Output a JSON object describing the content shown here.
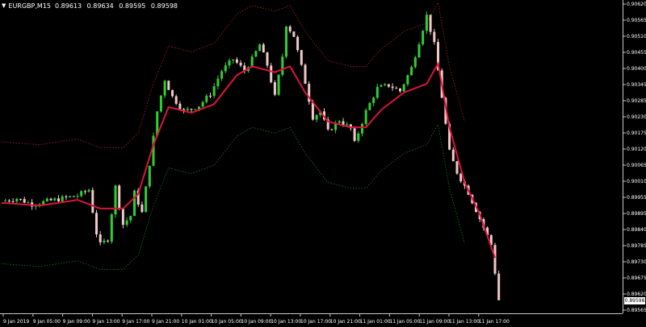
{
  "header": {
    "symbol": "EURGBP,M15",
    "open": "0.89613",
    "high": "0.89634",
    "low": "0.89595",
    "close": "0.89598",
    "menu_icon": "triangle-down-icon"
  },
  "price_axis": {
    "labels": [
      "0.90620",
      "0.90565",
      "0.90510",
      "0.90455",
      "0.90400",
      "0.90345",
      "0.90285",
      "0.90230",
      "0.90175",
      "0.90120",
      "0.90065",
      "0.90010",
      "0.89955",
      "0.89895",
      "0.89840",
      "0.89785",
      "0.89730",
      "0.89675",
      "0.89620",
      "0.89565"
    ],
    "current_price": "0.89598"
  },
  "time_axis": {
    "labels": [
      "9 Jan 2019",
      "9 Jan 05:00",
      "9 Jan 09:00",
      "9 Jan 13:00",
      "9 Jan 17:00",
      "9 Jan 21:00",
      "10 Jan 01:00",
      "10 Jan 05:00",
      "10 Jan 09:00",
      "10 Jan 13:00",
      "10 Jan 17:00",
      "10 Jan 21:00",
      "11 Jan 01:00",
      "11 Jan 05:00",
      "11 Jan 09:00",
      "11 Jan 13:00",
      "11 Jan 17:00"
    ]
  },
  "colors": {
    "background": "#000000",
    "bull_candle": "#32cd32",
    "bear_candle": "#f0c8c8",
    "center_line": "#dc143c",
    "upper_band": "#b22222",
    "lower_band": "#1f7a1f",
    "axis_text": "#ffffff",
    "axis_line": "#c8c8c8"
  },
  "chart_data": {
    "type": "candlestick",
    "ylim": [
      0.89565,
      0.9062
    ],
    "path_anchors": [
      [
        0.8994,
        0
      ],
      [
        0.8995,
        4
      ],
      [
        0.8993,
        8
      ],
      [
        0.8994,
        12
      ],
      [
        0.8995,
        16
      ],
      [
        0.8996,
        20
      ],
      [
        0.8998,
        23
      ],
      [
        0.8983,
        25
      ],
      [
        0.8979,
        26
      ],
      [
        0.8981,
        28
      ],
      [
        0.8999,
        30
      ],
      [
        0.8986,
        32
      ],
      [
        0.8989,
        34
      ],
      [
        0.8997,
        35
      ],
      [
        0.899,
        37
      ],
      [
        0.9007,
        39
      ],
      [
        0.9025,
        41
      ],
      [
        0.9036,
        43
      ],
      [
        0.903,
        45
      ],
      [
        0.9025,
        48
      ],
      [
        0.9027,
        52
      ],
      [
        0.9031,
        55
      ],
      [
        0.9039,
        58
      ],
      [
        0.9043,
        61
      ],
      [
        0.9039,
        64
      ],
      [
        0.9043,
        66
      ],
      [
        0.9048,
        68
      ],
      [
        0.9041,
        70
      ],
      [
        0.903,
        72
      ],
      [
        0.9044,
        74
      ],
      [
        0.9055,
        75
      ],
      [
        0.9051,
        77
      ],
      [
        0.9035,
        80
      ],
      [
        0.9023,
        82
      ],
      [
        0.9025,
        84
      ],
      [
        0.9018,
        86
      ],
      [
        0.9022,
        89
      ],
      [
        0.9019,
        92
      ],
      [
        0.9014,
        93
      ],
      [
        0.9025,
        96
      ],
      [
        0.9033,
        99
      ],
      [
        0.9034,
        102
      ],
      [
        0.9032,
        105
      ],
      [
        0.904,
        108
      ],
      [
        0.9058,
        112
      ],
      [
        0.9048,
        114
      ],
      [
        0.903,
        116
      ],
      [
        0.9011,
        118
      ],
      [
        0.9004,
        120
      ],
      [
        0.8997,
        123
      ],
      [
        0.8988,
        126
      ],
      [
        0.8979,
        129
      ],
      [
        0.896,
        131
      ]
    ],
    "center_line_anchors": [
      [
        0.89935,
        0
      ],
      [
        0.89925,
        10
      ],
      [
        0.89945,
        20
      ],
      [
        0.89915,
        26
      ],
      [
        0.89915,
        32
      ],
      [
        0.89965,
        36
      ],
      [
        0.90135,
        40
      ],
      [
        0.90265,
        44
      ],
      [
        0.90245,
        50
      ],
      [
        0.90275,
        56
      ],
      [
        0.90375,
        62
      ],
      [
        0.90405,
        66
      ],
      [
        0.90385,
        72
      ],
      [
        0.90405,
        76
      ],
      [
        0.90315,
        80
      ],
      [
        0.90215,
        86
      ],
      [
        0.90195,
        92
      ],
      [
        0.90195,
        96
      ],
      [
        0.90255,
        100
      ],
      [
        0.90315,
        106
      ],
      [
        0.90345,
        112
      ],
      [
        0.90415,
        115
      ],
      [
        0.90195,
        118
      ],
      [
        0.90005,
        122
      ],
      [
        0.89895,
        126
      ],
      [
        0.89745,
        130
      ]
    ],
    "band_offset": 0.0021
  }
}
